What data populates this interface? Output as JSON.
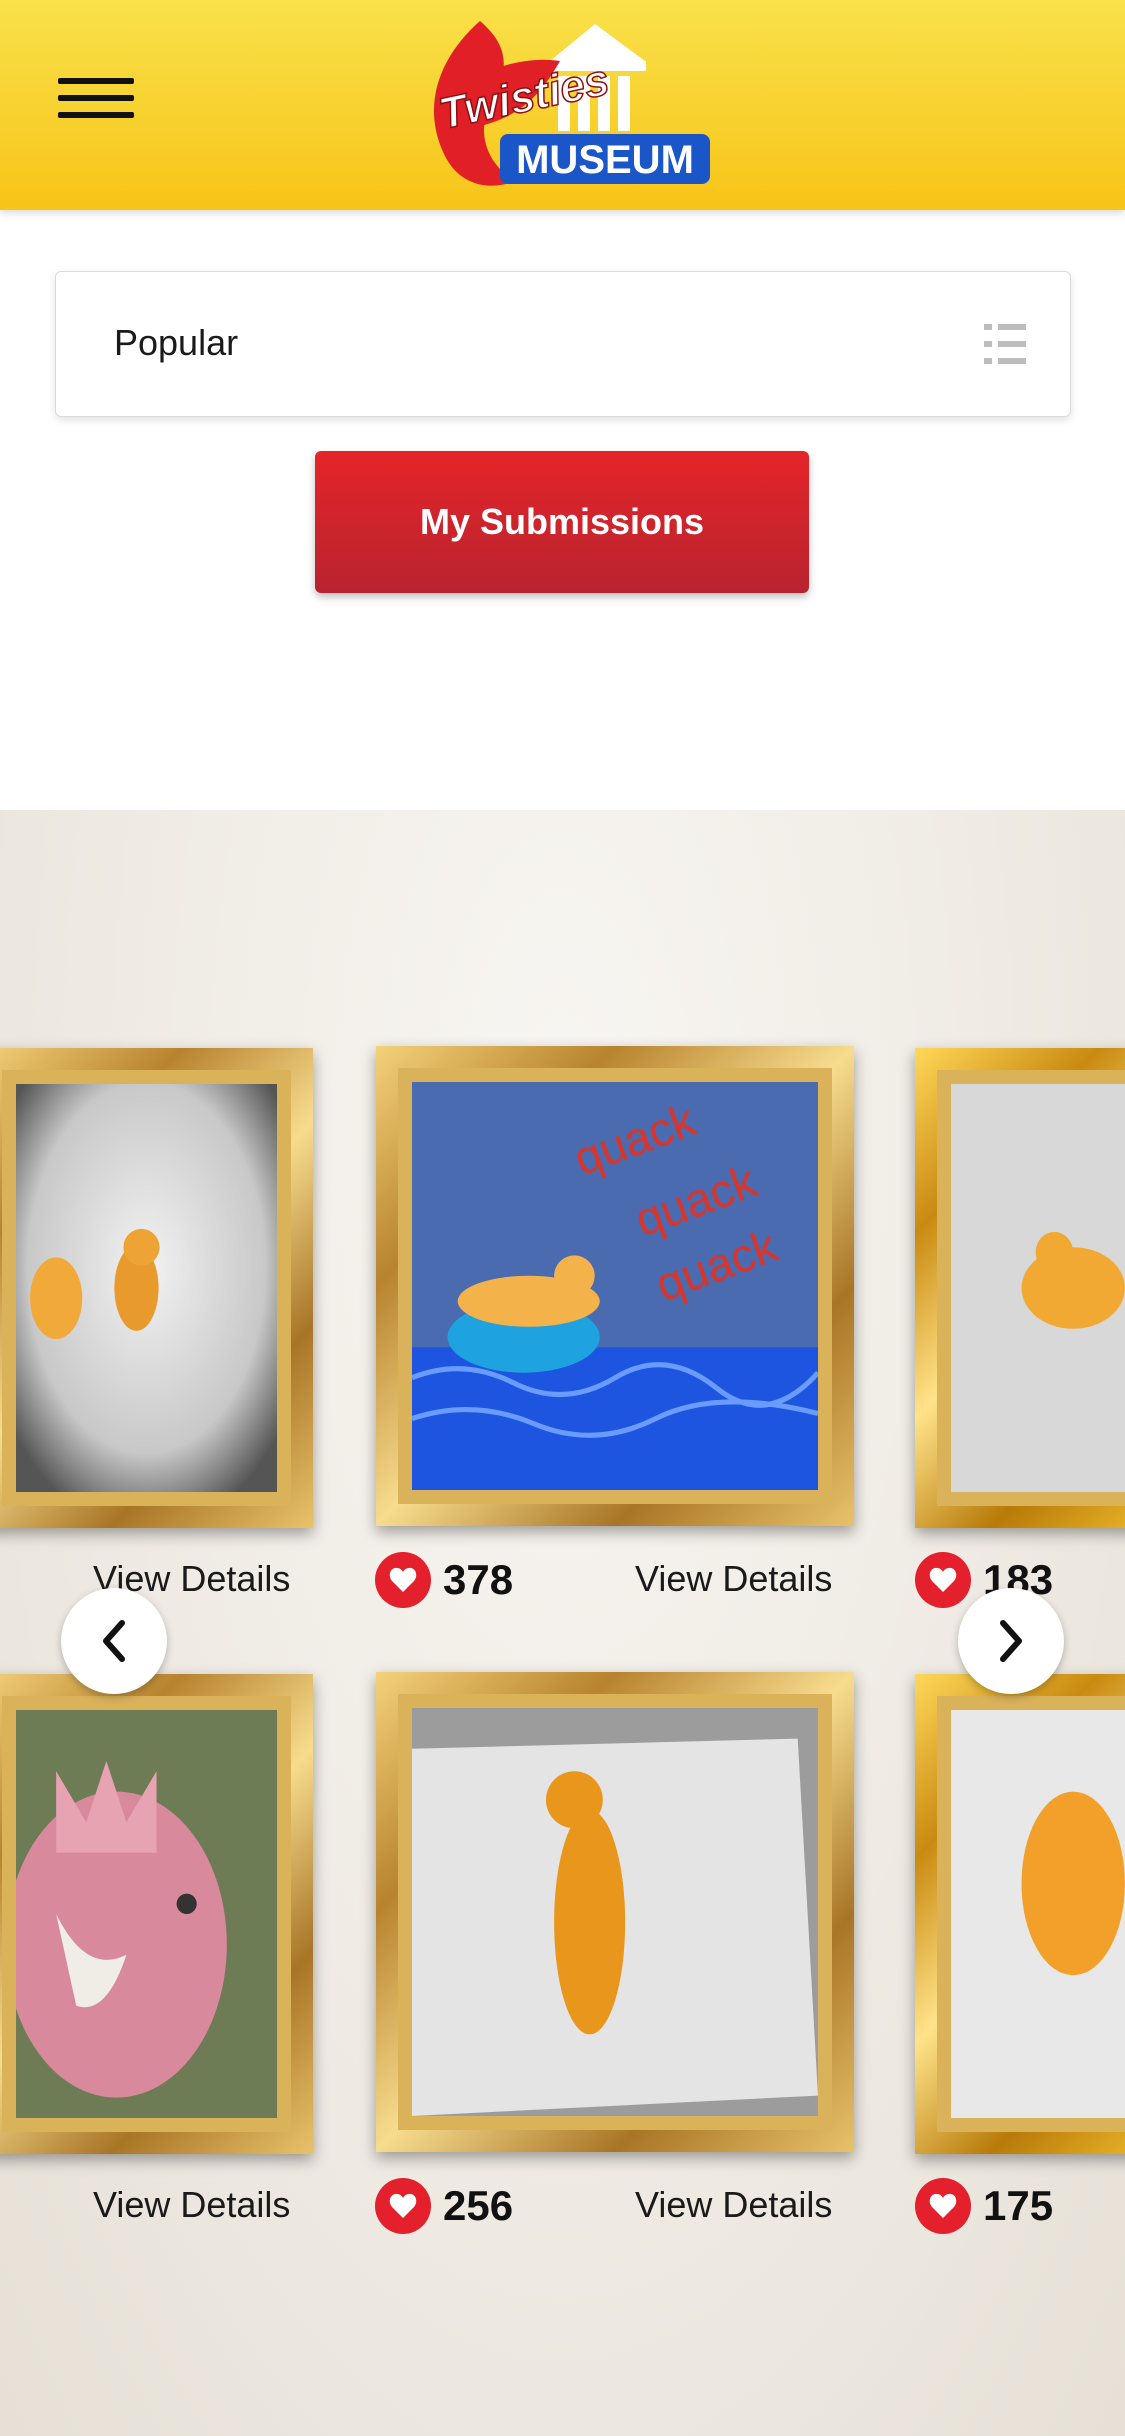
{
  "header": {
    "menu_icon": "hamburger-menu-icon",
    "logo_text_top": "Twisties",
    "logo_text_bottom": "MUSEUM"
  },
  "sort": {
    "selected": "Popular",
    "icon": "list-icon"
  },
  "actions": {
    "my_submissions": "My Submissions"
  },
  "gallery": {
    "view_details_label": "View Details",
    "items": [
      {
        "position": "row1-left",
        "likes": ""
      },
      {
        "position": "row1-center",
        "likes": "378",
        "caption_art": [
          "quack",
          "quack",
          "quack"
        ]
      },
      {
        "position": "row1-right",
        "likes": "183"
      },
      {
        "position": "row2-left",
        "likes": ""
      },
      {
        "position": "row2-center",
        "likes": "256"
      },
      {
        "position": "row2-right",
        "likes": "175"
      }
    ],
    "prev_icon": "chevron-left-icon",
    "next_icon": "chevron-right-icon"
  },
  "colors": {
    "header_yellow": "#f7c418",
    "button_red": "#d4232c",
    "heart_red": "#e3202b",
    "frame_gold": "#d9b25a"
  }
}
